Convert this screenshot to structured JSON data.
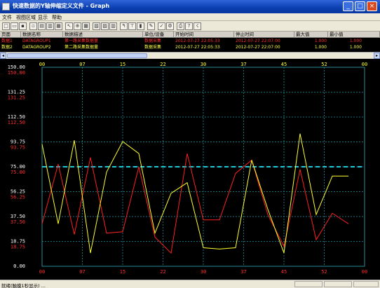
{
  "window": {
    "title": "快速数据的Y轴伸缩定义文件 - Graph",
    "minimize": "_",
    "maximize": "□",
    "close": "×"
  },
  "menu": [
    "文件",
    "视图区域",
    "显示",
    "帮助"
  ],
  "table": {
    "headers": [
      "页面",
      "数据名称",
      "数据描述",
      "单位/设备",
      "开始时间",
      "停止时间",
      "最大值",
      "最小值"
    ],
    "rows": [
      [
        "数据1",
        "DATAGROUP1",
        "第一路采集数据量",
        "数据采集",
        "2012-07-27 22:05:33",
        "2012-07-27 22:07:00",
        "1.000",
        "1.000"
      ],
      [
        "数据2",
        "DATAGROUP2",
        "第二路采集数据量",
        "数据采集",
        "2012-07-27 22:05:33",
        "2012-07-27 22:07:00",
        "1.000",
        "1.000"
      ]
    ],
    "colors": {
      "row1": "#ff3030",
      "row2": "#ffff40"
    }
  },
  "chart_data": {
    "type": "line",
    "y_ticks_white": [
      "150.00",
      "131.25",
      "112.50",
      "93.75",
      "75.00",
      "56.25",
      "37.50",
      "18.75",
      "0.00"
    ],
    "y_ticks_red": [
      "150.00",
      "131.25",
      "112.50",
      "93.75",
      "75.00",
      "56.25",
      "37.50",
      "18.75"
    ],
    "x_ticks": [
      "00",
      "07",
      "15",
      "22",
      "30",
      "37",
      "45",
      "52",
      "00"
    ],
    "ylim": [
      0,
      150
    ],
    "reference_line": 75,
    "x": [
      0,
      3,
      6,
      9,
      12,
      15,
      18,
      21,
      24,
      27,
      30,
      33,
      36,
      39,
      42,
      45,
      48,
      51,
      54,
      57
    ],
    "series": [
      {
        "color": "#ff2020",
        "values": [
          32,
          77,
          24,
          82,
          25,
          26,
          75,
          22,
          10,
          85,
          35,
          35,
          70,
          80,
          39,
          15,
          73,
          20,
          40,
          32
        ]
      },
      {
        "color": "#ffff30",
        "values": [
          92,
          32,
          95,
          10,
          71,
          94,
          85,
          25,
          55,
          63,
          14,
          13,
          14,
          80,
          43,
          10,
          100,
          39,
          68,
          68
        ]
      }
    ],
    "grid": true,
    "background": "#000000"
  },
  "status": {
    "text": "就绪(触摸1秒显示) ..."
  }
}
